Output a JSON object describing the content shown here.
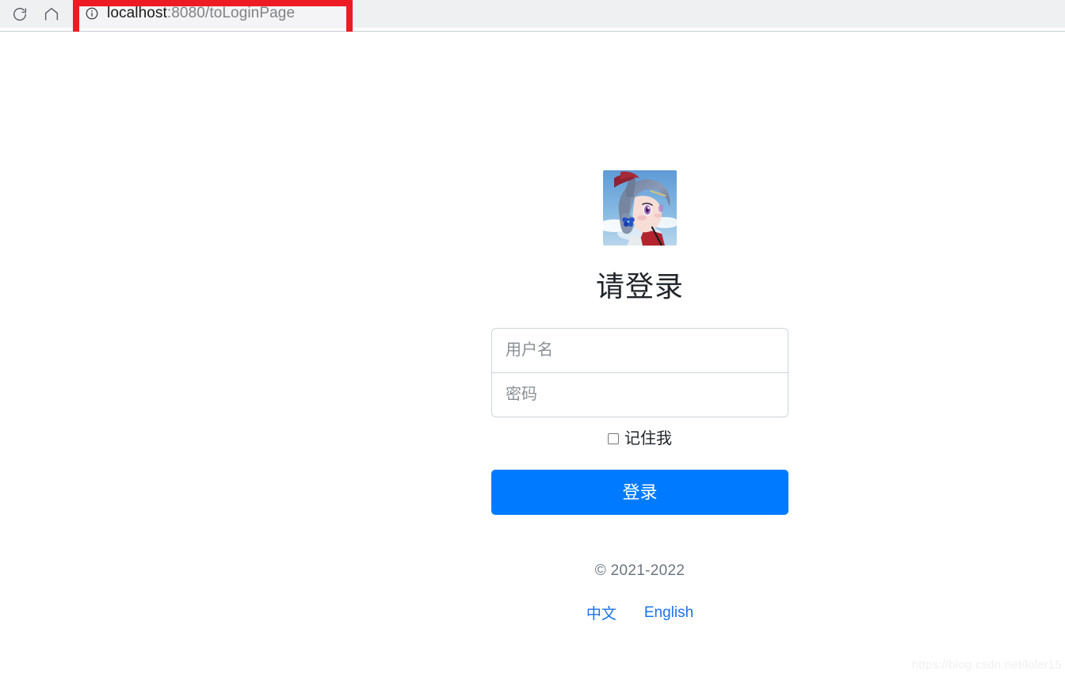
{
  "browser": {
    "reload_icon": "reload-icon",
    "home_icon": "home-icon",
    "info_icon": "info-circle-icon",
    "url_host": "localhost",
    "url_rest": ":8080/toLoginPage",
    "url_full": "localhost:8080/toLoginPage"
  },
  "annotation": {
    "color": "#ed1c24",
    "shape": "rectangle"
  },
  "login": {
    "avatar_alt": "avatar-image",
    "heading": "请登录",
    "username": {
      "placeholder": "用户名",
      "value": ""
    },
    "password": {
      "placeholder": "密码",
      "value": ""
    },
    "remember_label": "记住我",
    "remember_checked": false,
    "submit_label": "登录",
    "submit_color": "#007bff"
  },
  "footer": {
    "copyright": "© 2021-2022",
    "languages": [
      {
        "label": "中文"
      },
      {
        "label": "English"
      }
    ],
    "link_color": "#1a73e8"
  },
  "watermark": {
    "text": "https://blog.csdn.net/loler15"
  }
}
